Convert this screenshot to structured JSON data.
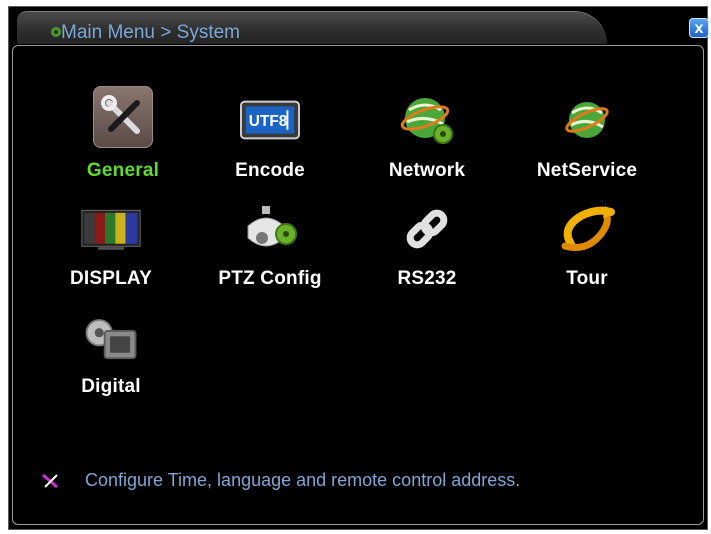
{
  "title": "Main Menu > System",
  "close_label": "x",
  "items": [
    {
      "label": "General",
      "selected": true,
      "icon": "wrench-screwdriver-icon"
    },
    {
      "label": "Encode",
      "selected": false,
      "icon": "utf8-encode-icon"
    },
    {
      "label": "Network",
      "selected": false,
      "icon": "network-globe-gear-icon"
    },
    {
      "label": "NetService",
      "selected": false,
      "icon": "netservice-globe-icon"
    },
    {
      "label": "DISPLAY",
      "selected": false,
      "icon": "monitor-display-icon"
    },
    {
      "label": "PTZ Config",
      "selected": false,
      "icon": "ptz-camera-gear-icon"
    },
    {
      "label": "RS232",
      "selected": false,
      "icon": "chain-link-icon"
    },
    {
      "label": "Tour",
      "selected": false,
      "icon": "tour-rotate-icon"
    },
    {
      "label": "Digital",
      "selected": false,
      "icon": "digital-camera-gear-icon"
    }
  ],
  "icon_text": {
    "encode": "UTF8"
  },
  "hint": "Configure Time, language and remote control address.",
  "colors": {
    "selected_label": "#5fdc2a",
    "hint_text": "#7fa6d6",
    "title_text": "#7aa7d8"
  }
}
